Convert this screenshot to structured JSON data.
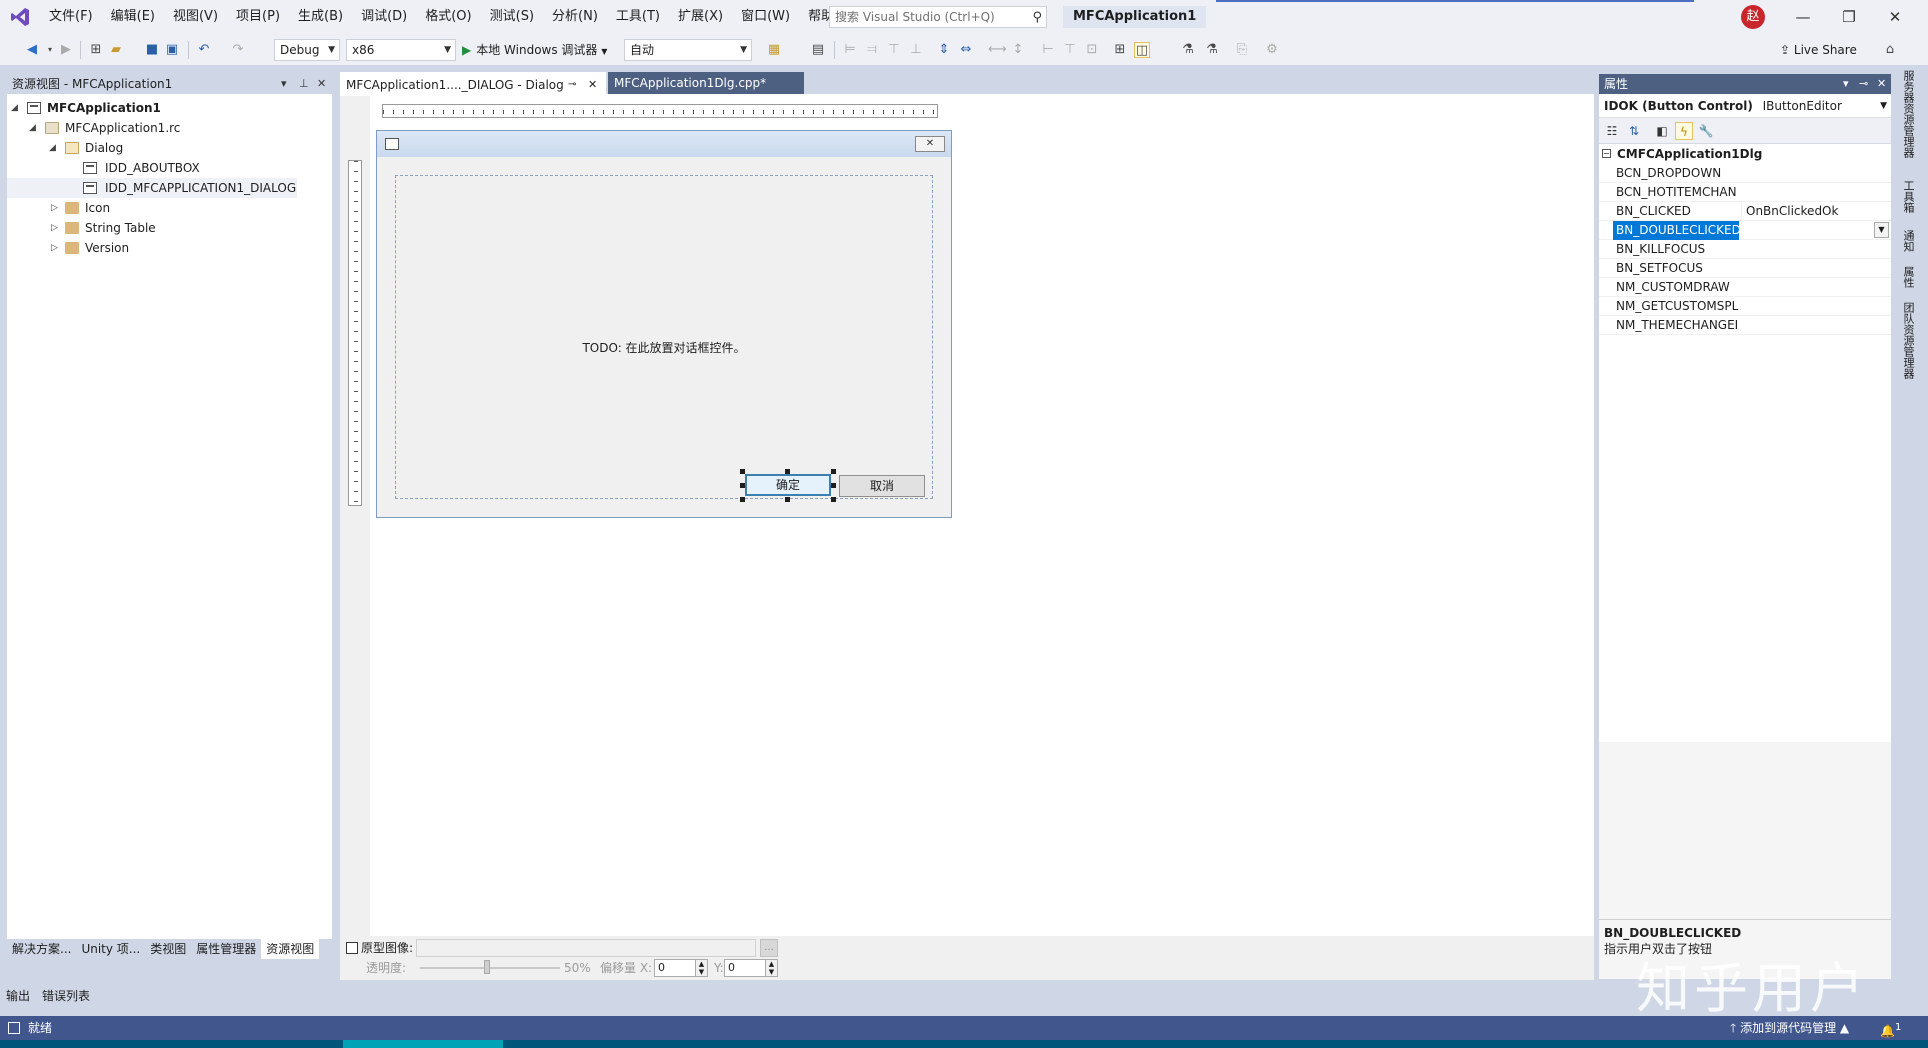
{
  "menu": {
    "items": [
      "文件(F)",
      "编辑(E)",
      "视图(V)",
      "项目(P)",
      "生成(B)",
      "调试(D)",
      "格式(O)",
      "测试(S)",
      "分析(N)",
      "工具(T)",
      "扩展(X)",
      "窗口(W)",
      "帮助(H)"
    ],
    "search_placeholder": "搜索 Visual Studio (Ctrl+Q)",
    "app_title": "MFCApplication1",
    "avatar": "赵"
  },
  "toolbar": {
    "config": "Debug",
    "platform": "x86",
    "run_label": "本地 Windows 调试器",
    "run_mode": "自动",
    "live_share": "Live Share"
  },
  "left_panel": {
    "title": "资源视图 - MFCApplication1",
    "tree": {
      "root": "MFCApplication1",
      "rc": "MFCApplication1.rc",
      "dialog": "Dialog",
      "aboutbox": "IDD_ABOUTBOX",
      "main_dialog": "IDD_MFCAPPLICATION1_DIALOG",
      "icon": "Icon",
      "string_table": "String Table",
      "version": "Version"
    },
    "tabs": [
      "解决方案...",
      "Unity 项...",
      "类视图",
      "属性管理器",
      "资源视图"
    ]
  },
  "documents": {
    "tab1": "MFCApplication1...._DIALOG - Dialog",
    "tab2": "MFCApplication1Dlg.cpp*"
  },
  "dialog": {
    "todo": "TODO: 在此放置对话框控件。",
    "ok": "确定",
    "cancel": "取消"
  },
  "doc_bottom": {
    "prototype_label": "原型图像:",
    "browse": "...",
    "opacity_label": "透明度:",
    "opacity_value": "50%",
    "offset_label": "偏移量 X:",
    "x_value": "0",
    "y_label": "Y:",
    "y_value": "0"
  },
  "properties": {
    "title": "属性",
    "object": "IDOK (Button Control)",
    "object_editor": "IButtonEditor",
    "category": "CMFCApplication1Dlg",
    "rows": [
      {
        "name": "BCN_DROPDOWN",
        "value": ""
      },
      {
        "name": "BCN_HOTITEMCHAN",
        "value": ""
      },
      {
        "name": "BN_CLICKED",
        "value": "OnBnClickedOk"
      },
      {
        "name": "BN_DOUBLECLICKED",
        "value": ""
      },
      {
        "name": "BN_KILLFOCUS",
        "value": ""
      },
      {
        "name": "BN_SETFOCUS",
        "value": ""
      },
      {
        "name": "NM_CUSTOMDRAW",
        "value": ""
      },
      {
        "name": "NM_GETCUSTOMSPL",
        "value": ""
      },
      {
        "name": "NM_THEMECHANGEI",
        "value": ""
      }
    ],
    "selected_row": 3,
    "desc_title": "BN_DOUBLECLICKED",
    "desc_text": "指示用户双击了按钮"
  },
  "side_tabs": [
    "服务器资源管理器",
    "工具箱",
    "通知",
    "属性",
    "团队资源管理器"
  ],
  "output_tabs": [
    "输出",
    "错误列表"
  ],
  "status": {
    "ready": "就绪",
    "source_control": "添加到源代码管理 ▲",
    "notifications": "1"
  },
  "watermark": "知乎用户",
  "colors": {
    "accent": "#40568d",
    "selection": "#0078d7",
    "tab_active": "#4d6082"
  }
}
